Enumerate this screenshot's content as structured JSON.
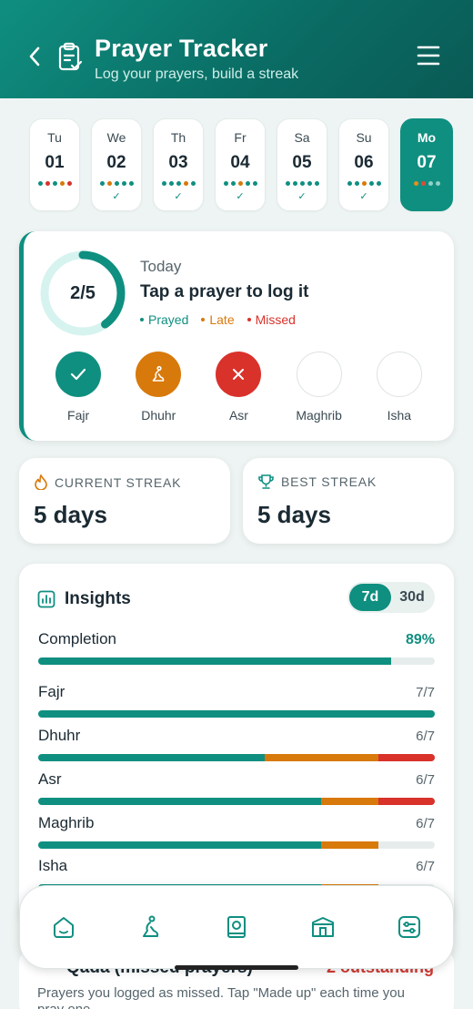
{
  "header": {
    "title": "Prayer Tracker",
    "subtitle": "Log your prayers, build a streak"
  },
  "days": [
    {
      "name": "Tu",
      "num": "01",
      "dots": [
        "#0f8f80",
        "#d8322b",
        "#0f8f80",
        "#d8790b",
        "#d8322b"
      ],
      "check": false
    },
    {
      "name": "We",
      "num": "02",
      "dots": [
        "#0f8f80",
        "#d8790b",
        "#0f8f80",
        "#0f8f80",
        "#0f8f80"
      ],
      "check": true
    },
    {
      "name": "Th",
      "num": "03",
      "dots": [
        "#0f8f80",
        "#0f8f80",
        "#0f8f80",
        "#d8790b",
        "#0f8f80"
      ],
      "check": true
    },
    {
      "name": "Fr",
      "num": "04",
      "dots": [
        "#0f8f80",
        "#0f8f80",
        "#d8790b",
        "#0f8f80",
        "#0f8f80"
      ],
      "check": true
    },
    {
      "name": "Sa",
      "num": "05",
      "dots": [
        "#0f8f80",
        "#0f8f80",
        "#0f8f80",
        "#0f8f80",
        "#0f8f80"
      ],
      "check": true
    },
    {
      "name": "Su",
      "num": "06",
      "dots": [
        "#0f8f80",
        "#0f8f80",
        "#d8790b",
        "#0f8f80",
        "#0f8f80"
      ],
      "check": true
    },
    {
      "name": "Mo",
      "num": "07",
      "dots": [
        "#e0901f",
        "#e04a3a",
        "#8fd1c8",
        "#8fd1c8"
      ],
      "check": false,
      "active": true
    }
  ],
  "today": {
    "progress": "2/5",
    "progress_fraction": 0.4,
    "label": "Today",
    "title": "Tap a prayer to log it",
    "legend": [
      {
        "text": "Prayed",
        "color": "#0f8f80"
      },
      {
        "text": "Late",
        "color": "#d8790b"
      },
      {
        "text": "Missed",
        "color": "#d8322b"
      }
    ],
    "prayers": [
      {
        "name": "Fajr",
        "status": "prayed",
        "icon": "check-icon"
      },
      {
        "name": "Dhuhr",
        "status": "late",
        "icon": "prayer-person-icon"
      },
      {
        "name": "Asr",
        "status": "missed",
        "icon": "close-icon"
      },
      {
        "name": "Maghrib",
        "status": "pending",
        "icon": ""
      },
      {
        "name": "Isha",
        "status": "pending",
        "icon": ""
      }
    ]
  },
  "streaks": {
    "current": {
      "label": "CURRENT STREAK",
      "value": "5 days",
      "icon": "flame-icon"
    },
    "best": {
      "label": "BEST STREAK",
      "value": "5 days",
      "icon": "trophy-icon"
    }
  },
  "insights": {
    "title": "Insights",
    "toggle": [
      "7d",
      "30d"
    ],
    "active_toggle": "7d",
    "completion": {
      "label": "Completion",
      "value": "89%",
      "fraction": 0.89
    },
    "rows": [
      {
        "name": "Fajr",
        "value": "7/7",
        "prayed": 1.0,
        "late": 0,
        "missed": 0
      },
      {
        "name": "Dhuhr",
        "value": "6/7",
        "prayed": 0.571,
        "late": 0.286,
        "missed": 0.143
      },
      {
        "name": "Asr",
        "value": "6/7",
        "prayed": 0.714,
        "late": 0.143,
        "missed": 0.143
      },
      {
        "name": "Maghrib",
        "value": "6/7",
        "prayed": 0.714,
        "late": 0.143,
        "missed": 0
      },
      {
        "name": "Isha",
        "value": "6/7",
        "prayed": 0.714,
        "late": 0.143,
        "missed": 0
      }
    ]
  },
  "qada": {
    "title": "Qada (missed prayers)",
    "badge": "2 outstanding",
    "text": "Prayers you logged as missed. Tap \"Made up\" each time you pray one."
  },
  "colors": {
    "teal": "#0f8f80",
    "late": "#d8790b",
    "missed": "#d8322b"
  }
}
